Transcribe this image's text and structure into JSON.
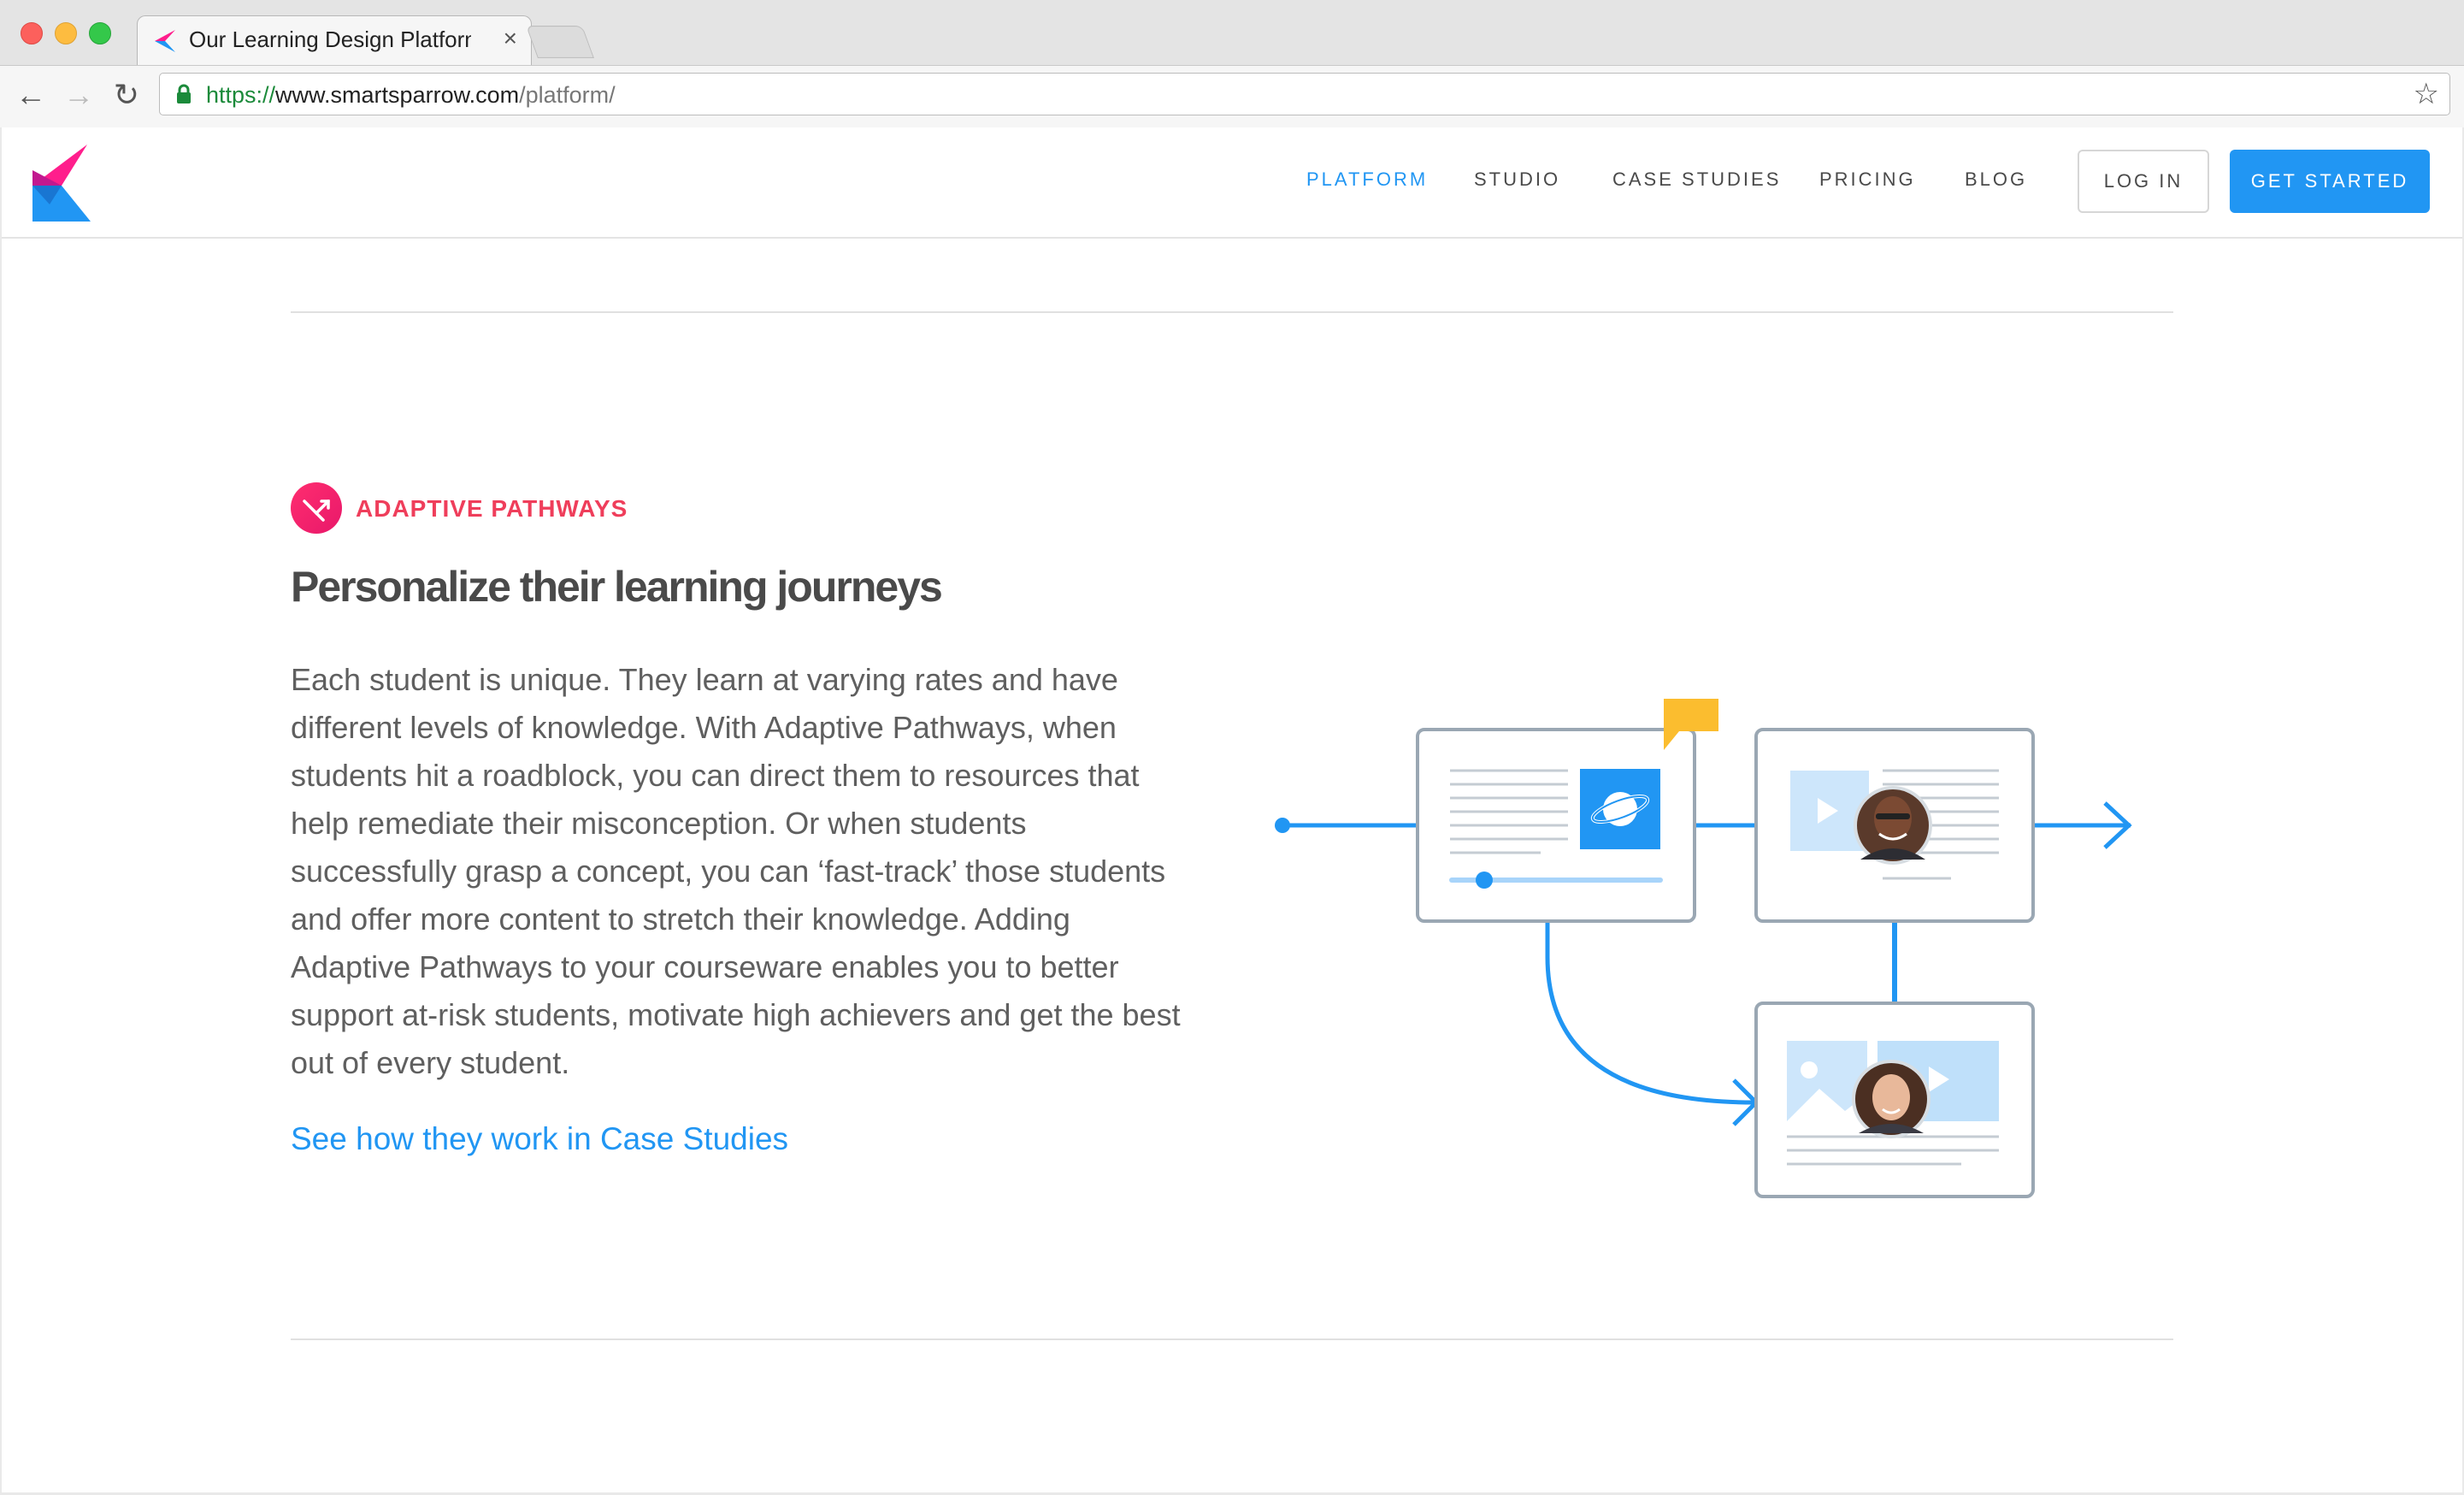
{
  "browser": {
    "tab_title": "Our Learning Design Platform",
    "tab_close": "×",
    "url_scheme": "https://",
    "url_host": "www.smartsparrow.com",
    "url_path": "/platform/",
    "back_icon": "←",
    "forward_icon": "→",
    "reload_icon": "↻",
    "star_icon": "☆"
  },
  "header": {
    "nav": [
      {
        "label": "PLATFORM",
        "active": true
      },
      {
        "label": "STUDIO"
      },
      {
        "label": "CASE STUDIES"
      },
      {
        "label": "PRICING"
      },
      {
        "label": "BLOG"
      }
    ],
    "login_label": "LOG IN",
    "cta_label": "GET STARTED"
  },
  "feature": {
    "eyebrow": "ADAPTIVE PATHWAYS",
    "heading": "Personalize their learning journeys",
    "body_lines": [
      "Each student is unique. They learn at varying rates and have",
      "different levels of knowledge. With Adaptive Pathways, when",
      "students hit a roadblock, you can direct them to resources that",
      "help remediate their misconception. Or when students",
      "successfully grasp a concept, you can ‘fast-track’ those students",
      "and offer more content to stretch their knowledge. Adding",
      "Adaptive Pathways to your courseware enables you to better",
      "support at-risk students, motivate high achievers and get the best",
      "out of every student."
    ],
    "link_label": "See how they work in Case Studies"
  },
  "colors": {
    "brand_blue": "#2196f3",
    "brand_pink": "#ef3e5b",
    "accent_yellow": "#fbbd2f",
    "card_border": "#9aa7b3"
  }
}
